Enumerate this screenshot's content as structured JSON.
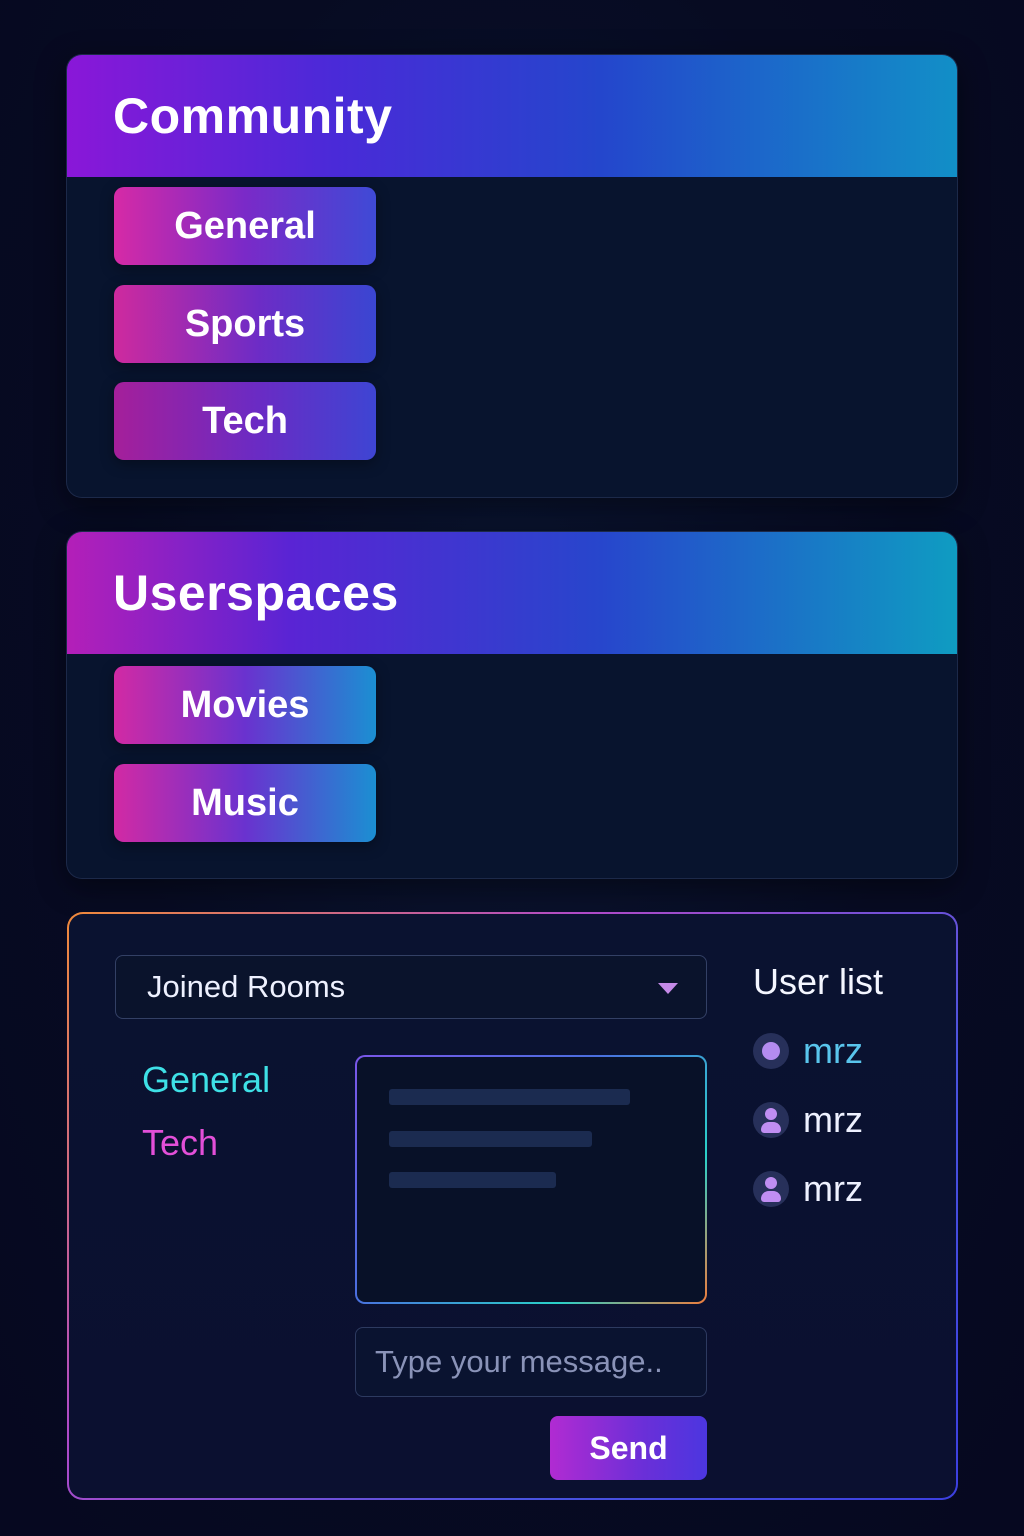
{
  "community": {
    "title": "Community",
    "rooms": [
      {
        "label": "General"
      },
      {
        "label": "Sports"
      },
      {
        "label": "Tech"
      }
    ]
  },
  "userspaces": {
    "title": "Userspaces",
    "rooms": [
      {
        "label": "Movies"
      },
      {
        "label": "Music"
      }
    ]
  },
  "chat": {
    "room_select": {
      "selected": "Joined Rooms",
      "icon": "chevron-down-icon"
    },
    "joined_rooms": [
      {
        "label": "General",
        "color": "#3ee0e6"
      },
      {
        "label": "Tech",
        "color": "#e34fd8"
      }
    ],
    "message_input": {
      "placeholder": "Type your message.."
    },
    "send_label": "Send",
    "user_list": {
      "title": "User list",
      "users": [
        {
          "name": "mrz",
          "icon": "status-dot-icon",
          "color": "#59c5ec"
        },
        {
          "name": "mrz",
          "icon": "user-icon",
          "color": "#eef1ff"
        },
        {
          "name": "mrz",
          "icon": "user-icon",
          "color": "#eef1ff"
        }
      ]
    }
  }
}
